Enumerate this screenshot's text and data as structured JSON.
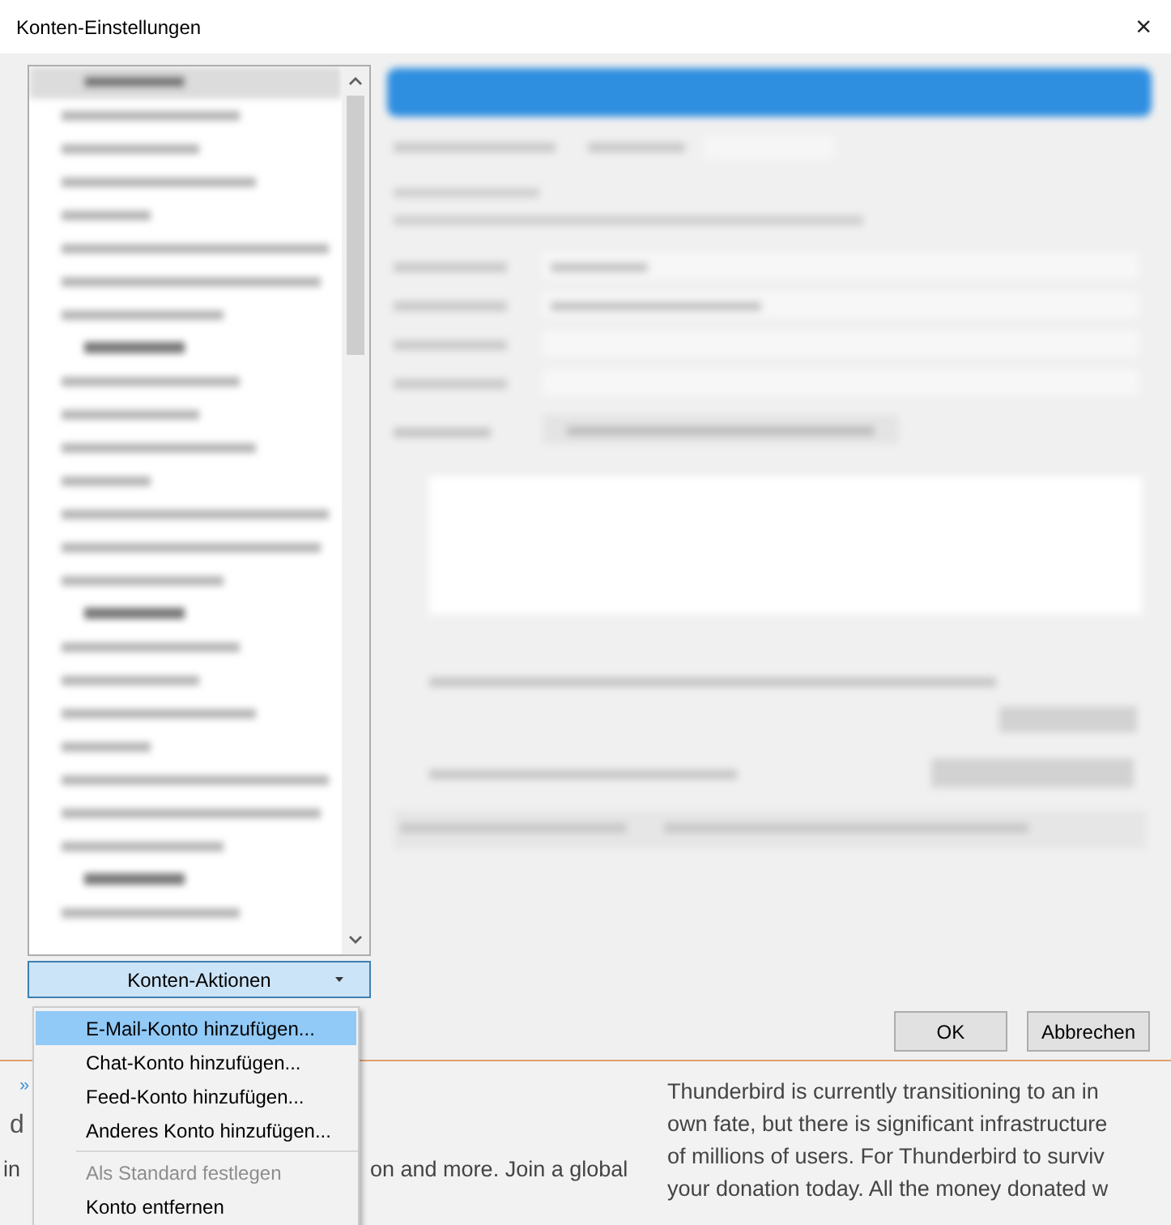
{
  "window": {
    "title": "Konten-Einstellungen",
    "close": "×"
  },
  "account_actions_button": {
    "label": "Konten-Aktionen"
  },
  "account_actions_menu": {
    "items": [
      {
        "kind": "item",
        "label": "E-Mail-Konto hinzufügen...",
        "selected": true,
        "disabled": false
      },
      {
        "kind": "item",
        "label": "Chat-Konto hinzufügen...",
        "selected": false,
        "disabled": false
      },
      {
        "kind": "item",
        "label": "Feed-Konto hinzufügen...",
        "selected": false,
        "disabled": false
      },
      {
        "kind": "item",
        "label": "Anderes Konto hinzufügen...",
        "selected": false,
        "disabled": false
      },
      {
        "kind": "separator"
      },
      {
        "kind": "item",
        "label": "Als Standard festlegen",
        "selected": false,
        "disabled": true
      },
      {
        "kind": "item",
        "label": "Konto entfernen",
        "selected": false,
        "disabled": false
      }
    ]
  },
  "buttons": [
    {
      "label": "OK"
    },
    {
      "label": "Abbrechen"
    }
  ],
  "background_page": {
    "nav_mark": "»",
    "heading_fragment": "d",
    "line_fragments": [
      "in",
      "on and more. Join a global"
    ],
    "paragraph_lines": [
      "Thunderbird is currently transitioning to an in",
      "own fate, but there is significant infrastructure",
      "of millions of users. For Thunderbird to surviv",
      "your donation today. All the money donated w"
    ]
  }
}
